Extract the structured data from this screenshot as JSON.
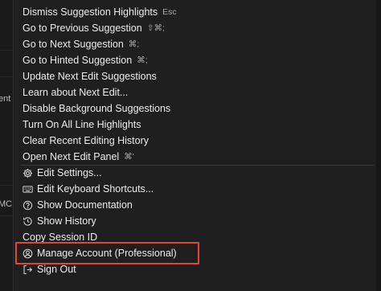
{
  "menu": {
    "items": [
      {
        "label": "Dismiss Suggestion Highlights",
        "shortcut": "Esc"
      },
      {
        "label": "Go to Previous Suggestion",
        "shortcut": "⇧⌘;"
      },
      {
        "label": "Go to Next Suggestion",
        "shortcut": "⌘;"
      },
      {
        "label": "Go to Hinted Suggestion",
        "shortcut": "⌘;"
      },
      {
        "label": "Update Next Edit Suggestions",
        "shortcut": ""
      },
      {
        "label": "Learn about Next Edit...",
        "shortcut": ""
      },
      {
        "label": "Disable Background Suggestions",
        "shortcut": ""
      },
      {
        "label": "Turn On All Line Highlights",
        "shortcut": ""
      },
      {
        "label": "Clear Recent Editing History",
        "shortcut": ""
      },
      {
        "label": "Open Next Edit Panel",
        "shortcut": "⌘'"
      }
    ],
    "settings_items": [
      {
        "label": "Edit Settings...",
        "icon": "gear-icon"
      },
      {
        "label": "Edit Keyboard Shortcuts...",
        "icon": "keyboard-icon"
      },
      {
        "label": "Show Documentation",
        "icon": "help-circle-icon"
      },
      {
        "label": "Show History",
        "icon": "history-icon"
      },
      {
        "label": "Copy Session ID",
        "icon": ""
      },
      {
        "label": "Manage Account (Professional)",
        "icon": "account-icon"
      },
      {
        "label": "Sign Out",
        "icon": "sign-out-icon"
      }
    ]
  },
  "background": {
    "fragment_1": "ent",
    "fragment_2": "MC"
  },
  "colors": {
    "menu_bg": "#1f1f1f",
    "text": "#ececec",
    "shortcut": "#a9a9a9",
    "highlight_box": "#e0492c"
  }
}
